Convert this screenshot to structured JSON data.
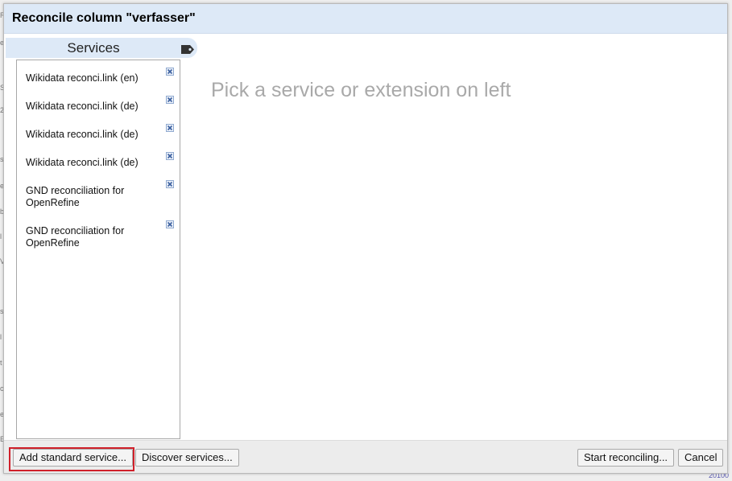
{
  "background": {
    "fragments": [
      "R",
      "e",
      "S",
      "2",
      "s",
      "e",
      "b",
      "l",
      "V",
      "s",
      "l",
      "t",
      "c",
      "e",
      "E"
    ],
    "bottom_right": "20100"
  },
  "dialog": {
    "title": "Reconcile column \"verfasser\""
  },
  "sidebar": {
    "heading": "Services",
    "heading_icon": "tag-icon",
    "items": [
      {
        "label": "Wikidata reconci.link (en)",
        "remove_icon": "remove-icon"
      },
      {
        "label": "Wikidata reconci.link (de)",
        "remove_icon": "remove-icon"
      },
      {
        "label": "Wikidata reconci.link (de)",
        "remove_icon": "remove-icon"
      },
      {
        "label": "Wikidata reconci.link (de)",
        "remove_icon": "remove-icon"
      },
      {
        "label": "GND reconciliation for OpenRefine",
        "remove_icon": "remove-icon"
      },
      {
        "label": "GND reconciliation for OpenRefine",
        "remove_icon": "remove-icon"
      }
    ]
  },
  "main": {
    "placeholder": "Pick a service or extension on left"
  },
  "footer": {
    "add_standard_service": "Add standard service...",
    "discover_services": "Discover services...",
    "start_reconciling": "Start reconciling...",
    "cancel": "Cancel"
  },
  "colors": {
    "header_bg": "#dde9f7",
    "highlight": "#d0202a",
    "placeholder": "#a9a9a9"
  }
}
